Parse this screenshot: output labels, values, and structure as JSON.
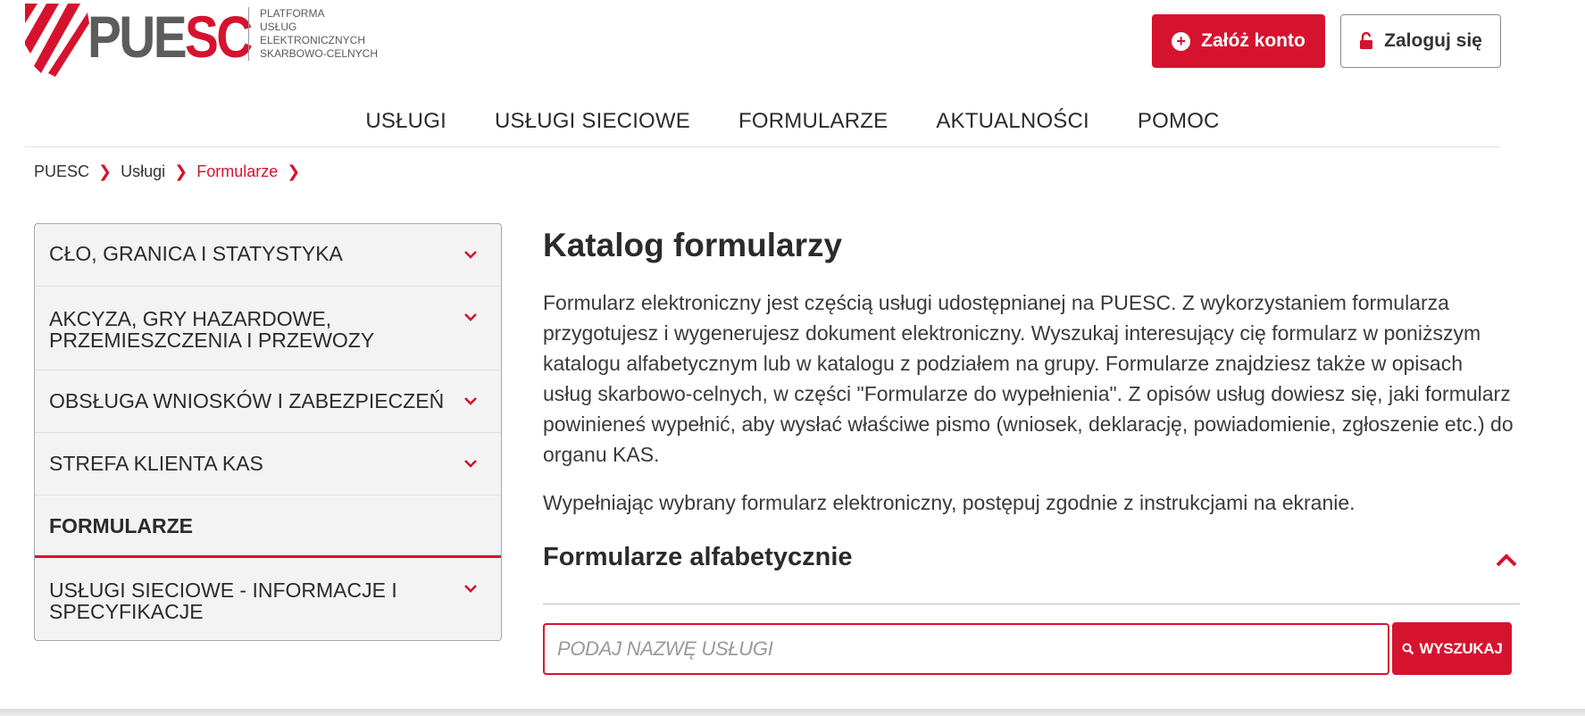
{
  "header": {
    "logo_text_gray": "PUE",
    "logo_text_red": "SC",
    "logo_subtitle_lines": [
      "PLATFORMA",
      "USŁUG",
      "ELEKTRONICZNYCH",
      "SKARBOWO-CELNYCH"
    ],
    "register_button": "Załóż konto",
    "login_button": "Zaloguj się"
  },
  "nav": {
    "items": [
      "USŁUGI",
      "USŁUGI SIECIOWE",
      "FORMULARZE",
      "AKTUALNOŚCI",
      "POMOC"
    ]
  },
  "breadcrumb": {
    "items": [
      "PUESC",
      "Usługi",
      "Formularze"
    ]
  },
  "sidebar": {
    "items": [
      {
        "label": "CŁO, GRANICA I STATYSTYKA"
      },
      {
        "label": "AKCYZA, GRY HAZARDOWE, PRZEMIESZCZENIA I PRZEWOZY"
      },
      {
        "label": "OBSŁUGA WNIOSKÓW I ZABEZPIECZEŃ"
      },
      {
        "label": "STREFA KLIENTA KAS"
      },
      {
        "label": "FORMULARZE"
      },
      {
        "label": "USŁUGI SIECIOWE - INFORMACJE I SPECYFIKACJE"
      }
    ]
  },
  "main": {
    "title": "Katalog formularzy",
    "intro": "Formularz elektroniczny jest częścią usługi udostępnianej na PUESC. Z wykorzystaniem formularza przygotujesz i wygenerujesz dokument elektroniczny. Wyszukaj interesujący cię formularz w poniższym katalogu alfabetycznym lub w katalogu z podziałem na grupy. Formularze znajdziesz także w opisach usług skarbowo-celnych, w części \"Formularze do wypełnienia\". Z opisów usług dowiesz się, jaki formularz powinieneś wypełnić, aby wysłać właściwe pismo (wniosek, deklarację, powiadomienie, zgłoszenie etc.) do organu KAS.",
    "intro2": "Wypełniając wybrany formularz elektroniczny, postępuj zgodnie z instrukcjami na ekranie.",
    "section_title": "Formularze alfabetycznie",
    "search": {
      "placeholder": "PODAJ NAZWĘ USŁUGI",
      "value": "",
      "button": "WYSZUKAJ"
    }
  },
  "colors": {
    "accent": "#d6132f",
    "text": "#2b2b2b",
    "sidebar_bg": "#f3f3f3"
  }
}
